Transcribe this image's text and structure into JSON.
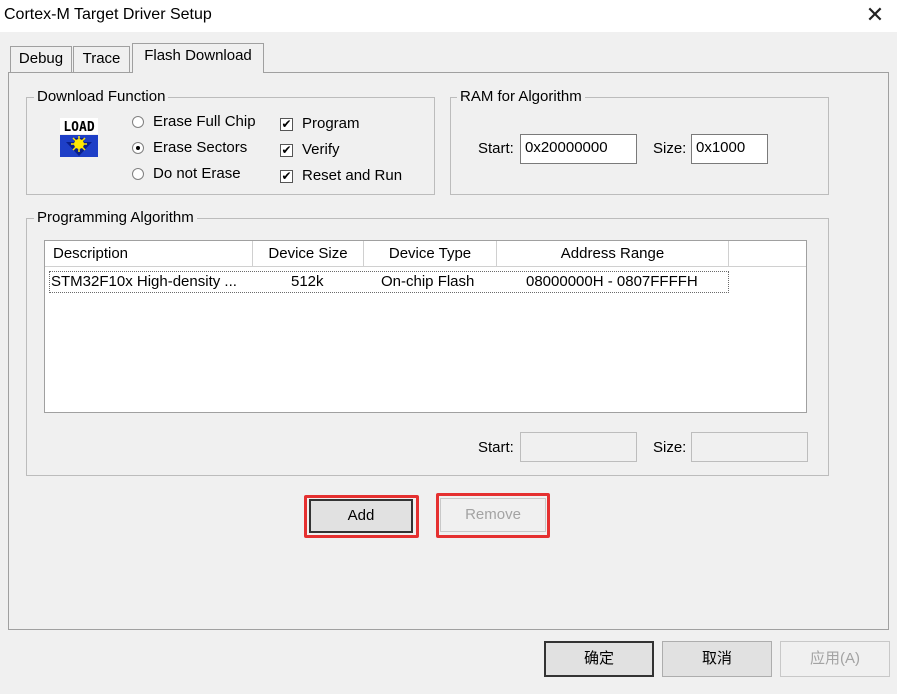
{
  "window": {
    "title": "Cortex-M Target Driver Setup",
    "close_glyph": "✕"
  },
  "tabs": [
    {
      "label": "Debug"
    },
    {
      "label": "Trace"
    },
    {
      "label": "Flash Download"
    }
  ],
  "download_function": {
    "title": "Download Function",
    "icon_text": "LOAD",
    "erase_options": [
      {
        "label": "Erase Full Chip",
        "selected": false
      },
      {
        "label": "Erase Sectors",
        "selected": true
      },
      {
        "label": "Do not Erase",
        "selected": false
      }
    ],
    "checks": [
      {
        "label": "Program",
        "checked": true
      },
      {
        "label": "Verify",
        "checked": true
      },
      {
        "label": "Reset and Run",
        "checked": true
      }
    ],
    "check_glyph": "✔"
  },
  "ram": {
    "title": "RAM for Algorithm",
    "start_label": "Start:",
    "start_value": "0x20000000",
    "size_label": "Size:",
    "size_value": "0x1000"
  },
  "programming_algorithm": {
    "title": "Programming Algorithm",
    "columns": [
      "Description",
      "Device Size",
      "Device Type",
      "Address Range"
    ],
    "rows": [
      [
        "STM32F10x High-density ...",
        "512k",
        "On-chip Flash",
        "08000000H - 0807FFFFH"
      ]
    ],
    "start_label": "Start:",
    "start_value": "",
    "size_label": "Size:",
    "size_value": ""
  },
  "actions": {
    "add_label": "Add",
    "remove_label": "Remove"
  },
  "footer": {
    "ok_label": "确定",
    "cancel_label": "取消",
    "apply_label": "应用(A)"
  },
  "colors": {
    "highlight": "#e53030",
    "window_bg": "#f0f0f0",
    "icon_blue": "#1e3fc7",
    "icon_yellow": "#ffe800"
  }
}
